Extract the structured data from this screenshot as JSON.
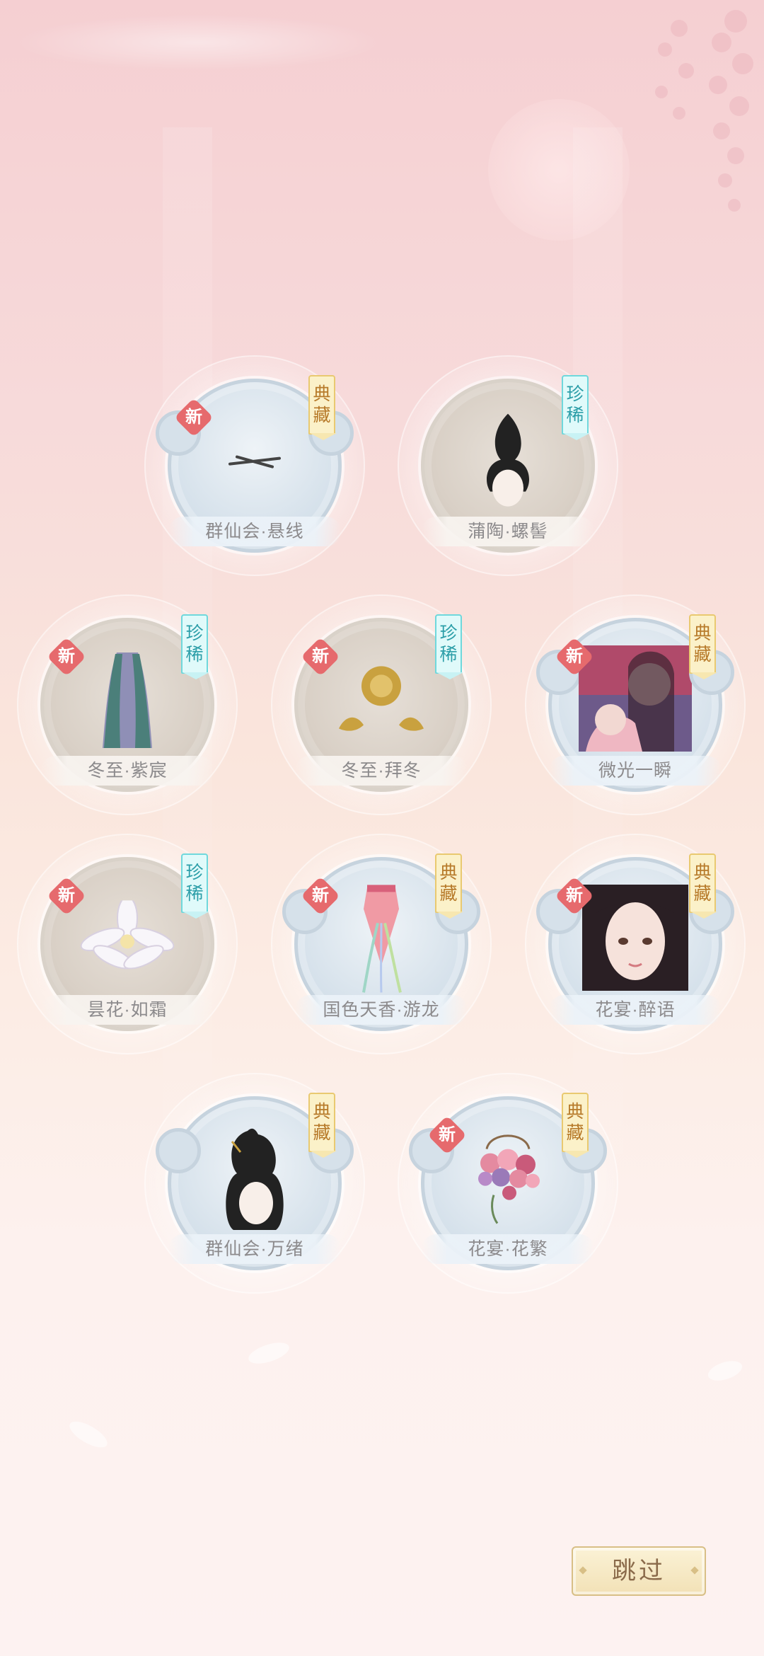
{
  "colors": {
    "new_badge": "#e66a6d",
    "rarity_gold": "#b77a2a",
    "rarity_cyan": "#2c9ea8",
    "name_text": "#8c8a8c",
    "skip_text": "#8a6a4a"
  },
  "new_label": "新",
  "items": [
    {
      "name": "群仙会·悬线",
      "rarity": "典藏",
      "rarity_style": "gold",
      "is_new": true,
      "frame": "cloud",
      "art_icon": "hair-thread-icon"
    },
    {
      "name": "蒲陶·螺髻",
      "rarity": "珍稀",
      "rarity_style": "cyan",
      "is_new": false,
      "frame": "round",
      "art_icon": "hair-bun-icon"
    },
    {
      "name": "冬至·紫宸",
      "rarity": "珍稀",
      "rarity_style": "cyan",
      "is_new": true,
      "frame": "round",
      "art_icon": "robe-icon"
    },
    {
      "name": "冬至·拜冬",
      "rarity": "珍稀",
      "rarity_style": "cyan",
      "is_new": true,
      "frame": "round",
      "art_icon": "gold-ornament-icon"
    },
    {
      "name": "微光一瞬",
      "rarity": "典藏",
      "rarity_style": "gold",
      "is_new": true,
      "frame": "cloud",
      "art_icon": "illustration-card-icon"
    },
    {
      "name": "昙花·如霜",
      "rarity": "珍稀",
      "rarity_style": "cyan",
      "is_new": true,
      "frame": "round",
      "art_icon": "white-flower-icon"
    },
    {
      "name": "国色天香·游龙",
      "rarity": "典藏",
      "rarity_style": "gold",
      "is_new": true,
      "frame": "cloud",
      "art_icon": "ribbon-accessory-icon"
    },
    {
      "name": "花宴·醉语",
      "rarity": "典藏",
      "rarity_style": "gold",
      "is_new": true,
      "frame": "cloud",
      "art_icon": "face-portrait-icon"
    },
    {
      "name": "群仙会·万绪",
      "rarity": "典藏",
      "rarity_style": "gold",
      "is_new": false,
      "frame": "cloud",
      "art_icon": "hairstyle-icon"
    },
    {
      "name": "花宴·花繁",
      "rarity": "典藏",
      "rarity_style": "gold",
      "is_new": true,
      "frame": "cloud",
      "art_icon": "flower-bouquet-icon"
    }
  ],
  "rarity_labels": {
    "dian_cang": [
      "典",
      "藏"
    ],
    "zhen_xi": [
      "珍",
      "稀"
    ]
  },
  "skip_button": {
    "label": "跳过"
  }
}
